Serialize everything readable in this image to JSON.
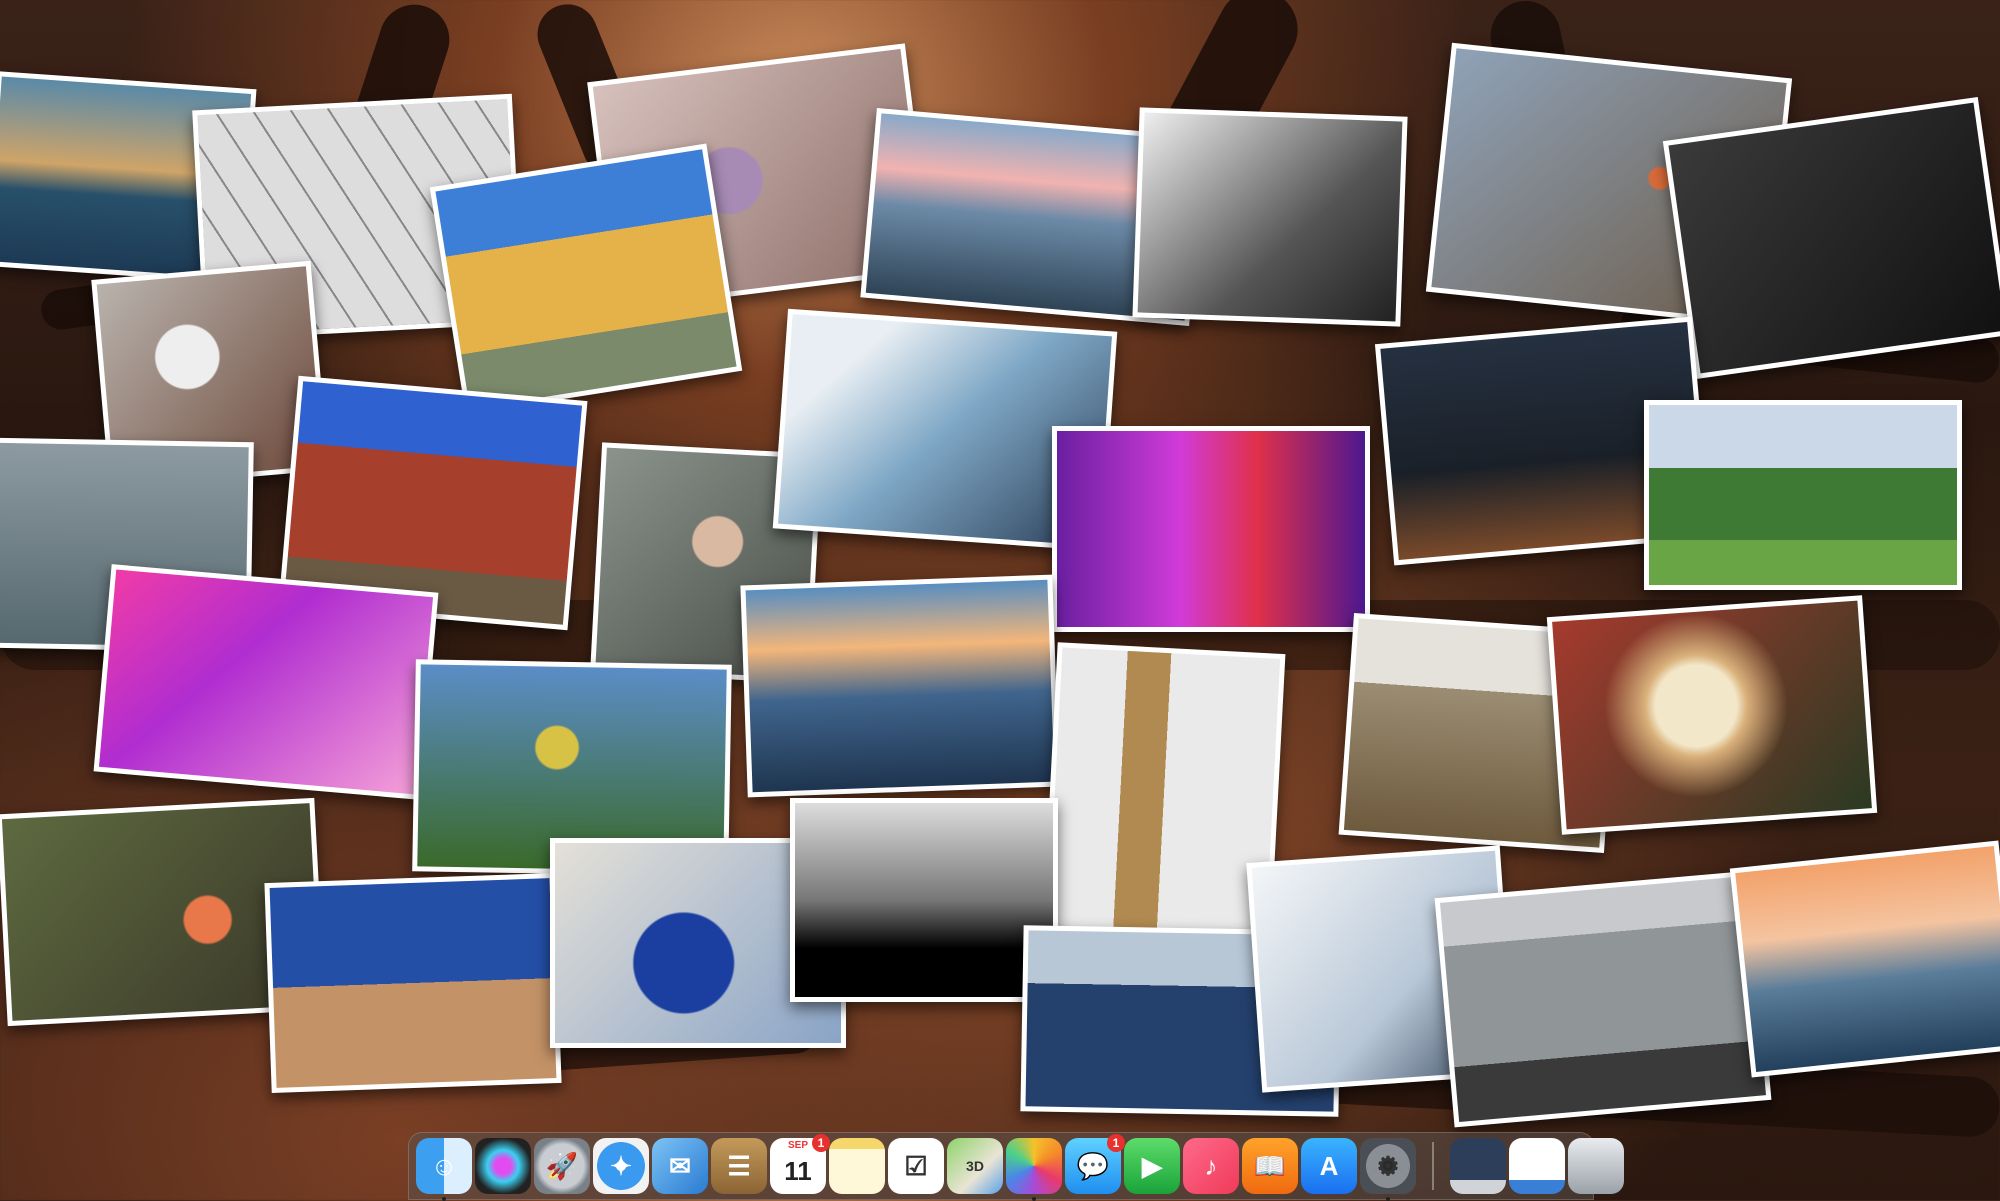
{
  "desktop": {
    "wallpaper": "tree-silhouette-sunset",
    "photos": [
      {
        "name": "photo-sea-sunrise-clouds"
      },
      {
        "name": "photo-glass-roof-building"
      },
      {
        "name": "photo-pink-flower-blur"
      },
      {
        "name": "photo-yellow-house-street"
      },
      {
        "name": "photo-pier-sunset-beach"
      },
      {
        "name": "photo-tulips-black-white"
      },
      {
        "name": "photo-robin-on-branch"
      },
      {
        "name": "photo-train-interior-bw"
      },
      {
        "name": "photo-snowdrop-flower"
      },
      {
        "name": "photo-grey-heron"
      },
      {
        "name": "photo-timber-houses-street"
      },
      {
        "name": "photo-woman-on-bicycle"
      },
      {
        "name": "photo-architecture-arch"
      },
      {
        "name": "photo-purple-neon-room"
      },
      {
        "name": "photo-railway-yard-night"
      },
      {
        "name": "photo-castle-park"
      },
      {
        "name": "photo-pink-tunnel"
      },
      {
        "name": "photo-yellowhammer-bird"
      },
      {
        "name": "photo-beach-sunset-tide"
      },
      {
        "name": "photo-ship-rigging-mast"
      },
      {
        "name": "photo-couple-walking-beam"
      },
      {
        "name": "photo-food-closeup"
      },
      {
        "name": "photo-greylag-goose"
      },
      {
        "name": "photo-old-church-dunes"
      },
      {
        "name": "photo-peacock"
      },
      {
        "name": "photo-windmill-silhouette"
      },
      {
        "name": "photo-kitesurfer"
      },
      {
        "name": "photo-snowy-walk"
      },
      {
        "name": "photo-man-on-shore-bw"
      },
      {
        "name": "photo-beach-pink-sunset"
      }
    ]
  },
  "dock": {
    "apps": [
      {
        "name": "finder",
        "icon": "finder-icon",
        "label": "",
        "running": true
      },
      {
        "name": "siri",
        "icon": "siri-icon",
        "label": "",
        "running": false
      },
      {
        "name": "launchpad",
        "icon": "launchpad-icon",
        "label": "",
        "running": false
      },
      {
        "name": "safari",
        "icon": "safari-icon",
        "label": "",
        "running": false
      },
      {
        "name": "mail",
        "icon": "mail-icon",
        "label": "",
        "running": false
      },
      {
        "name": "contacts",
        "icon": "contacts-icon",
        "label": "",
        "running": false
      },
      {
        "name": "calendar",
        "icon": "calendar-icon",
        "label": "11",
        "month": "SEP",
        "badge": "1",
        "running": false
      },
      {
        "name": "notes",
        "icon": "notes-icon",
        "label": "",
        "running": false
      },
      {
        "name": "reminders",
        "icon": "reminders-icon",
        "label": "",
        "running": false
      },
      {
        "name": "maps",
        "icon": "maps-icon",
        "label": "3D",
        "running": false
      },
      {
        "name": "photos",
        "icon": "photos-icon",
        "label": "",
        "running": true
      },
      {
        "name": "messages",
        "icon": "messages-icon",
        "label": "",
        "badge": "1",
        "running": false
      },
      {
        "name": "facetime",
        "icon": "facetime-icon",
        "label": "",
        "running": false
      },
      {
        "name": "music",
        "icon": "music-icon",
        "label": "",
        "running": false
      },
      {
        "name": "books",
        "icon": "books-icon",
        "label": "",
        "running": false
      },
      {
        "name": "app-store",
        "icon": "app-store-icon",
        "label": "",
        "running": false
      },
      {
        "name": "system-preferences",
        "icon": "gear-icon",
        "label": "",
        "running": true
      }
    ],
    "extras": [
      {
        "name": "desktop-screen",
        "icon": "monitor-icon"
      },
      {
        "name": "screen-sharing",
        "icon": "screen-share-icon"
      },
      {
        "name": "trash",
        "icon": "trash-icon"
      }
    ]
  }
}
